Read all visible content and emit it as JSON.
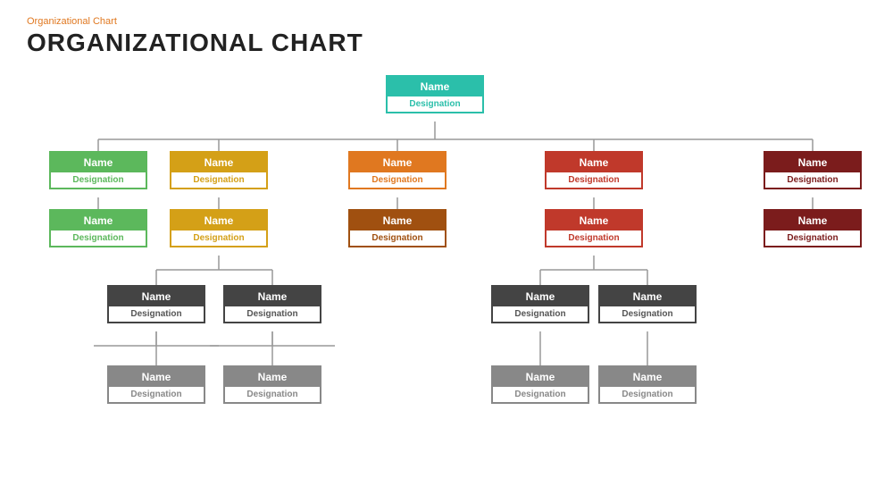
{
  "header": {
    "subtitle": "Organizational  Chart",
    "title": "ORGANIZATIONAL CHART"
  },
  "nodes": {
    "root": {
      "name": "Name",
      "designation": "Designation"
    },
    "l1_1": {
      "name": "Name",
      "designation": "Designation"
    },
    "l1_2": {
      "name": "Name",
      "designation": "Designation"
    },
    "l1_3": {
      "name": "Name",
      "designation": "Designation"
    },
    "l1_4": {
      "name": "Name",
      "designation": "Designation"
    },
    "l1_5": {
      "name": "Name",
      "designation": "Designation"
    },
    "l2_1": {
      "name": "Name",
      "designation": "Designation"
    },
    "l2_2": {
      "name": "Name",
      "designation": "Designation"
    },
    "l2_3": {
      "name": "Name",
      "designation": "Designation"
    },
    "l2_4": {
      "name": "Name",
      "designation": "Designation"
    },
    "l2_5": {
      "name": "Name",
      "designation": "Designation"
    },
    "l3_1": {
      "name": "Name",
      "designation": "Designation"
    },
    "l3_2": {
      "name": "Name",
      "designation": "Designation"
    },
    "l3_3": {
      "name": "Name",
      "designation": "Designation"
    },
    "l3_4": {
      "name": "Name",
      "designation": "Designation"
    },
    "l4_1": {
      "name": "Name",
      "designation": "Designation"
    },
    "l4_2": {
      "name": "Name",
      "designation": "Designation"
    },
    "l4_3": {
      "name": "Name",
      "designation": "Designation"
    },
    "l4_4": {
      "name": "Name",
      "designation": "Designation"
    }
  }
}
